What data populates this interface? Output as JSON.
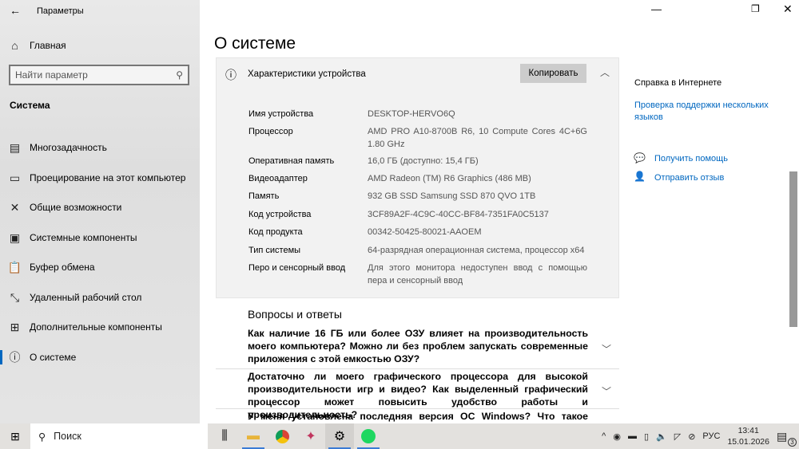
{
  "window": {
    "title": "Параметры"
  },
  "sidebar": {
    "home": "Главная",
    "search_placeholder": "Найти параметр",
    "section": "Система",
    "items": [
      {
        "label": "Многозадачность"
      },
      {
        "label": "Проецирование на этот компьютер"
      },
      {
        "label": "Общие возможности"
      },
      {
        "label": "Системные компоненты"
      },
      {
        "label": "Буфер обмена"
      },
      {
        "label": "Удаленный рабочий стол"
      },
      {
        "label": "Дополнительные компоненты"
      },
      {
        "label": "О системе"
      }
    ]
  },
  "main": {
    "title": "О системе",
    "card_title": "Характеристики устройства",
    "copy_button": "Копировать",
    "specs": [
      {
        "k": "Имя устройства",
        "v": "DESKTOP-HERVO6Q"
      },
      {
        "k": "Процессор",
        "v": "AMD PRO A10-8700B R6, 10 Compute Cores 4C+6G 1.80 GHz"
      },
      {
        "k": "Оперативная память",
        "v": "16,0 ГБ (доступно: 15,4 ГБ)"
      },
      {
        "k": "Видеоадаптер",
        "v": "AMD Radeon (TM) R6 Graphics (486 MB)"
      },
      {
        "k": "Память",
        "v": "932 GB SSD Samsung SSD 870 QVO 1TB"
      },
      {
        "k": "Код устройства",
        "v": "3CF89A2F-4C9C-40CC-BF84-7351FA0C5137"
      },
      {
        "k": "Код продукта",
        "v": "00342-50425-80021-AAOEM"
      },
      {
        "k": "Тип системы",
        "v": "64-разрядная операционная система, процессор x64"
      },
      {
        "k": "Перо и сенсорный ввод",
        "v": "Для этого монитора недоступен ввод с помощью пера и сенсорный ввод"
      }
    ],
    "qa_title": "Вопросы и ответы",
    "questions": [
      "Как наличие 16 ГБ или более ОЗУ влияет на производительность моего компьютера? Можно ли без проблем запускать современные приложения с этой емкостью ОЗУ?",
      "Достаточно ли моего графического процессора для высокой производительности игр и видео? Как выделенный графический процессор может повысить удобство работы и производительность?",
      "У меня установлена последняя версия ОС Windows? Что такое последняя"
    ]
  },
  "right": {
    "heading": "Справка в Интернете",
    "link": "Проверка поддержки нескольких языков",
    "help": "Получить помощь",
    "feedback": "Отправить отзыв"
  },
  "taskbar": {
    "search": "Поиск",
    "lang": "РУС",
    "time": "13:41",
    "date": "15.01.2026",
    "notifications": "3"
  }
}
